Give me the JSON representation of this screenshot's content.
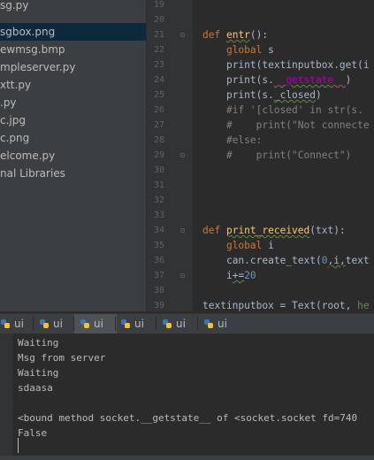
{
  "project_tree": {
    "items": [
      {
        "label": "sg.py"
      },
      {
        "label": "sgbox.png"
      },
      {
        "label": "ewmsg.bmp"
      },
      {
        "label": "mpleserver.py"
      },
      {
        "label": "xtt.py"
      },
      {
        "label": ".py"
      },
      {
        "label": "c.jpg"
      },
      {
        "label": "c.png"
      },
      {
        "label": "elcome.py"
      },
      {
        "label": "nal Libraries"
      }
    ],
    "selected_index": 1
  },
  "editor": {
    "line_numbers": [
      "19",
      "20",
      "21",
      "22",
      "23",
      "24",
      "25",
      "26",
      "27",
      "28",
      "29",
      "30",
      "31",
      "32",
      "33",
      "34",
      "35",
      "36",
      "37",
      "38",
      "39"
    ],
    "lines": {
      "l21_def": "def",
      "l21_name": "entr",
      "l21_rest": "():",
      "l22_kw": "global",
      "l22_var": " s",
      "l23_code": "print(textinputbox.get(i",
      "l24_a": "print(s.",
      "l24_dunder": "__getstate__",
      "l24_b": ")",
      "l25_a": "print(s.",
      "l25_b": "_closed",
      "l25_c": ")",
      "l26": "#if '[closed' in str(s.",
      "l27": "#    print(\"Not connecte",
      "l28": "#else:",
      "l29": "#    print(\"Connect\")",
      "l34_def": "def",
      "l34_name": "print_received",
      "l34_rest": "(txt):",
      "l35_kw": "global",
      "l35_var": " i",
      "l36_a": "can.create_text(",
      "l36_n0": "0",
      "l36_b": ",i,",
      "l36_c": "text",
      "l37_a": "i",
      "l37_b": "+=",
      "l37_n": "20",
      "l39_a": "textinputbox = Text(root, ",
      "l39_b": "he"
    }
  },
  "tabs": [
    {
      "label": "ui"
    },
    {
      "label": "ui"
    },
    {
      "label": "ui"
    },
    {
      "label": "ui"
    },
    {
      "label": "ui"
    },
    {
      "label": "ui"
    }
  ],
  "console": {
    "lines": [
      "Waiting",
      "Msg from server",
      "Waiting",
      "sdaasa",
      "",
      "<bound method socket.__getstate__ of <socket.socket fd=740",
      "False"
    ]
  },
  "colors": {
    "editor_bg": "#2b2b2b",
    "keyword": "#cc7832",
    "function_name": "#ffc66d",
    "comment": "#808080",
    "number": "#6897bb",
    "selection": "#0d293e"
  }
}
